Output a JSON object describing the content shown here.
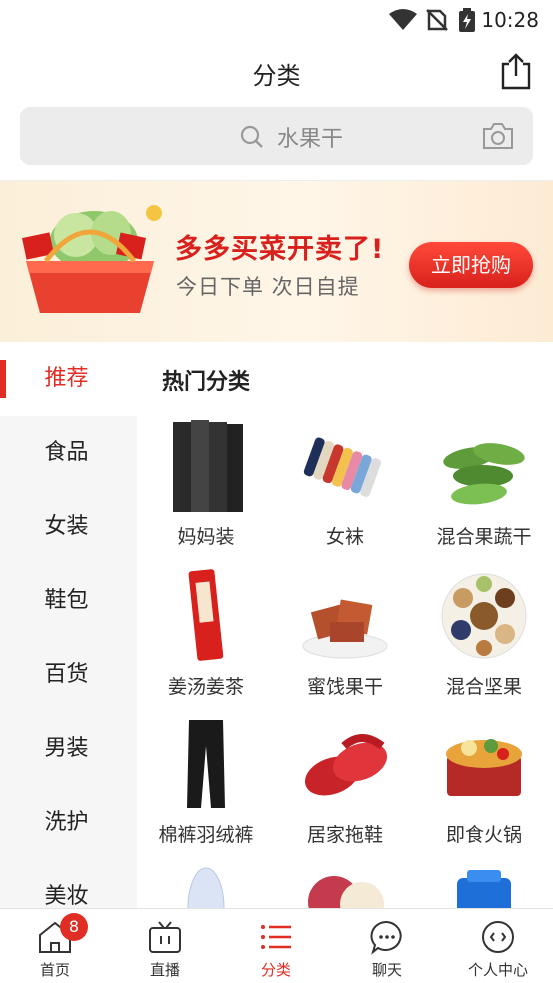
{
  "status_bar": {
    "time": "10:28"
  },
  "header": {
    "title": "分类"
  },
  "search": {
    "placeholder": "水果干"
  },
  "banner": {
    "title": "多多买菜开卖了!",
    "subtitle": "今日下单 次日自提",
    "button_label": "立即抢购"
  },
  "sidebar": {
    "items": [
      {
        "label": "推荐",
        "active": true
      },
      {
        "label": "食品"
      },
      {
        "label": "女装"
      },
      {
        "label": "鞋包"
      },
      {
        "label": "百货"
      },
      {
        "label": "男装"
      },
      {
        "label": "洗护"
      },
      {
        "label": "美妆"
      }
    ]
  },
  "content": {
    "section_title": "热门分类",
    "tiles": [
      {
        "label": "妈妈装",
        "icon": "clothes-icon"
      },
      {
        "label": "女袜",
        "icon": "socks-icon"
      },
      {
        "label": "混合果蔬干",
        "icon": "okra-icon"
      },
      {
        "label": "姜汤姜茶",
        "icon": "ginger-tea-icon"
      },
      {
        "label": "蜜饯果干",
        "icon": "candied-fruit-icon"
      },
      {
        "label": "混合坚果",
        "icon": "nuts-icon"
      },
      {
        "label": "棉裤羽绒裤",
        "icon": "pants-icon"
      },
      {
        "label": "居家拖鞋",
        "icon": "slippers-icon"
      },
      {
        "label": "即食火锅",
        "icon": "hotpot-icon"
      },
      {
        "label": "",
        "icon": "insole-icon"
      },
      {
        "label": "",
        "icon": "fruit-icon"
      },
      {
        "label": "",
        "icon": "blue-container-icon"
      }
    ]
  },
  "tabbar": {
    "badge_count": "8",
    "tabs": [
      {
        "label": "首页",
        "icon": "home-icon"
      },
      {
        "label": "直播",
        "icon": "tv-icon"
      },
      {
        "label": "分类",
        "icon": "list-icon",
        "active": true
      },
      {
        "label": "聊天",
        "icon": "chat-icon"
      },
      {
        "label": "个人中心",
        "icon": "profile-icon"
      }
    ]
  },
  "colors": {
    "accent": "#e02e24",
    "sidebar_bg": "#f6f6f6",
    "search_bg": "#ececec"
  }
}
